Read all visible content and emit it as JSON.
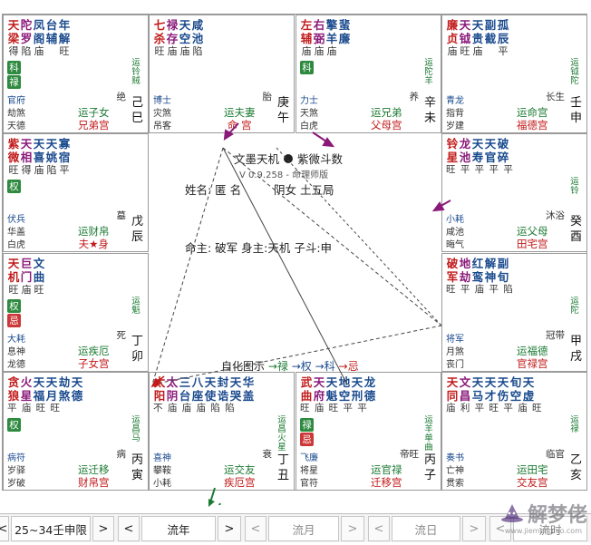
{
  "app": {
    "title": "文墨天机",
    "subtitle": "紫微斗数",
    "version": "V 0.9.258 - 命理师版"
  },
  "colors": {
    "green": "#1b7a32",
    "red": "#c21a1a",
    "blue": "#1a4a8e",
    "purple": "#8a1a7a"
  },
  "center": {
    "name_label": "姓名: 匿 名",
    "gender_label": "阴女 土五局",
    "ming_label": "命主: 破军 身主:天机 子斗:申",
    "legend_label": "自化图示",
    "legend_lu": "→禄",
    "legend_quan": "→权",
    "legend_ke": "→科",
    "legend_ji": "→忌"
  },
  "palaces": [
    {
      "id": "si",
      "stars": [
        [
          "天",
          "得"
        ],
        [
          "陀",
          "陷"
        ],
        [
          "凤",
          "庙"
        ],
        [
          "台",
          ""
        ],
        [
          "年",
          "旺"
        ]
      ],
      "stars2": [
        [
          "梁",
          ""
        ],
        [
          "罗",
          ""
        ],
        [
          "阁",
          ""
        ],
        [
          "辅",
          ""
        ],
        [
          "解",
          ""
        ]
      ],
      "badges": [
        "科",
        "禄"
      ],
      "minor1": "官府",
      "minor2": "劫煞",
      "minor3": "天德",
      "vlabel": "运铃贼",
      "stage": "绝",
      "gz1": "己",
      "gz2": "巳",
      "pal_top": "运子女",
      "pal_bot": "兄弟宫"
    },
    {
      "id": "wu",
      "stars": [
        [
          "七",
          "旺"
        ],
        [
          "禄",
          "庙"
        ],
        [
          "天",
          "庙"
        ],
        [
          "咸",
          "陷"
        ],
        [
          "",
          ""
        ]
      ],
      "stars2": [
        [
          "杀",
          ""
        ],
        [
          "存",
          ""
        ],
        [
          "空",
          ""
        ],
        [
          "池",
          ""
        ],
        [
          "",
          ""
        ]
      ],
      "badges": [],
      "minor1": "博士",
      "minor2": "灾煞",
      "minor3": "吊客",
      "vlabel": "",
      "stage": "胎",
      "gz1": "庚",
      "gz2": "午",
      "pal_top": "运夫妻",
      "pal_bot": "命 宫"
    },
    {
      "id": "wei",
      "stars": [
        [
          "左",
          "庙"
        ],
        [
          "右",
          "庙"
        ],
        [
          "擎",
          "庙"
        ],
        [
          "蜚",
          ""
        ],
        [
          "",
          ""
        ]
      ],
      "stars2": [
        [
          "辅",
          ""
        ],
        [
          "弼",
          ""
        ],
        [
          "羊",
          ""
        ],
        [
          "廉",
          ""
        ],
        [
          "",
          ""
        ]
      ],
      "badges": [
        "科"
      ],
      "minor1": "力士",
      "minor2": "天煞",
      "minor3": "白虎",
      "vlabel": "运陀羊",
      "stage": "养",
      "gz1": "辛",
      "gz2": "未",
      "pal_top": "运兄弟",
      "pal_bot": "父母宫"
    },
    {
      "id": "shen",
      "stars": [
        [
          "廉",
          "庙"
        ],
        [
          "天",
          "旺"
        ],
        [
          "天",
          "庙"
        ],
        [
          "副",
          ""
        ],
        [
          "孤",
          "平"
        ]
      ],
      "stars2": [
        [
          "贞",
          ""
        ],
        [
          "钺",
          ""
        ],
        [
          "贵",
          ""
        ],
        [
          "截",
          ""
        ],
        [
          "辰",
          ""
        ]
      ],
      "badges": [],
      "minor1": "青龙",
      "minor2": "指背",
      "minor3": "岁建",
      "vlabel": "运钺陀",
      "stage": "长生",
      "gz1": "壬",
      "gz2": "申",
      "pal_top": "运命宫",
      "pal_bot": "福德宫"
    },
    {
      "id": "chen",
      "stars": [
        [
          "紫",
          "旺"
        ],
        [
          "天",
          "得"
        ],
        [
          "天",
          "庙"
        ],
        [
          "天",
          "陷"
        ],
        [
          "寡",
          "平"
        ]
      ],
      "stars2": [
        [
          "微",
          ""
        ],
        [
          "相",
          ""
        ],
        [
          "喜",
          ""
        ],
        [
          "姚",
          ""
        ],
        [
          "宿",
          ""
        ]
      ],
      "badges": [
        "权"
      ],
      "minor1": "伏兵",
      "minor2": "华盖",
      "minor3": "白虎",
      "vlabel": "",
      "stage": "墓",
      "gz1": "戊",
      "gz2": "辰",
      "pal_top": "运财帛",
      "pal_bot": "夫★身"
    },
    {
      "id": "you",
      "stars": [
        [
          "铃",
          ""
        ],
        [
          "龙",
          ""
        ],
        [
          "天",
          ""
        ],
        [
          "天",
          ""
        ],
        [
          "破",
          ""
        ]
      ],
      "stars2": [
        [
          "星",
          ""
        ],
        [
          "池",
          ""
        ],
        [
          "寿",
          ""
        ],
        [
          "官",
          ""
        ],
        [
          "碎",
          ""
        ]
      ],
      "stars3": "旺 平 平 平 平",
      "badges": [],
      "minor1": "小耗",
      "minor2": "咸池",
      "minor3": "晦气",
      "vlabel": "运铃",
      "stage": "沐浴",
      "gz1": "癸",
      "gz2": "酉",
      "pal_top": "运父母",
      "pal_bot": "田宅宫"
    },
    {
      "id": "mao",
      "stars": [
        [
          "天",
          "旺"
        ],
        [
          "巨",
          "庙"
        ],
        [
          "文",
          "旺"
        ],
        [
          "",
          ""
        ],
        [
          "",
          ""
        ]
      ],
      "stars2": [
        [
          "机",
          ""
        ],
        [
          "门",
          ""
        ],
        [
          "曲",
          ""
        ],
        [
          "",
          ""
        ],
        [
          "",
          ""
        ]
      ],
      "badges": [
        "权",
        "忌"
      ],
      "minor1": "大耗",
      "minor2": "息神",
      "minor3": "龙德",
      "vlabel": "运魁",
      "stage": "死",
      "gz1": "丁",
      "gz2": "卯",
      "pal_top": "运疾厄",
      "pal_bot": "子女宫"
    },
    {
      "id": "xu",
      "stars": [
        [
          "破",
          ""
        ],
        [
          "地",
          ""
        ],
        [
          "红",
          ""
        ],
        [
          "解",
          ""
        ],
        [
          "副",
          ""
        ]
      ],
      "stars2": [
        [
          "军",
          ""
        ],
        [
          "劫",
          ""
        ],
        [
          "鸾",
          ""
        ],
        [
          "神",
          ""
        ],
        [
          "旬",
          ""
        ]
      ],
      "stars3": "旺 平 庙 平 陷",
      "extra": [
        [
          "大",
          ""
        ],
        [
          "月",
          ""
        ]
      ],
      "extra2": [
        [
          "耗",
          ""
        ],
        [
          "德",
          ""
        ]
      ],
      "badges": [],
      "minor1": "将军",
      "minor2": "月煞",
      "minor3": "丧门",
      "vlabel": "运陀",
      "stage": "冠带",
      "gz1": "甲",
      "gz2": "戌",
      "pal_top": "运福德",
      "pal_bot": "官禄宫"
    },
    {
      "id": "yin",
      "stars": [
        [
          "贪",
          ""
        ],
        [
          "火",
          ""
        ],
        [
          "天",
          ""
        ],
        [
          "天",
          ""
        ],
        [
          "劫",
          ""
        ],
        [
          "天",
          ""
        ]
      ],
      "stars2": [
        [
          "狼",
          ""
        ],
        [
          "星",
          ""
        ],
        [
          "福",
          ""
        ],
        [
          "月",
          ""
        ],
        [
          "煞",
          ""
        ],
        [
          "德",
          ""
        ]
      ],
      "stars3": "平 庙 旺 旺",
      "badges": [
        "权"
      ],
      "minor1": "病符",
      "minor2": "岁驿",
      "minor3": "岁破",
      "vlabel": "运昌 马",
      "stage": "病",
      "gz1": "丙",
      "gz2": "寅",
      "pal_top": "运迁移",
      "pal_bot": "财帛宫"
    },
    {
      "id": "chou",
      "stars": [
        [
          "太",
          ""
        ],
        [
          "太",
          ""
        ],
        [
          "三",
          ""
        ],
        [
          "八",
          ""
        ],
        [
          "天",
          ""
        ],
        [
          "封",
          ""
        ],
        [
          "天",
          ""
        ],
        [
          "华",
          ""
        ]
      ],
      "stars2": [
        [
          "阳",
          ""
        ],
        [
          "阴",
          ""
        ],
        [
          "台",
          ""
        ],
        [
          "座",
          ""
        ],
        [
          "使",
          ""
        ],
        [
          "诰",
          ""
        ],
        [
          "哭",
          ""
        ],
        [
          "盖",
          ""
        ]
      ],
      "stars3": "不 庙 庙 庙 陷 陷",
      "badges": [],
      "minor1": "喜神",
      "minor2": "攀鞍",
      "minor3": "小耗",
      "vlabel": "运昌 火星",
      "stage": "衰",
      "gz1": "丁",
      "gz2": "丑",
      "pal_top": "运交友",
      "pal_bot": "疾厄宫"
    },
    {
      "id": "zi",
      "stars": [
        [
          "武",
          ""
        ],
        [
          "天",
          ""
        ],
        [
          "天",
          ""
        ],
        [
          "地",
          ""
        ],
        [
          "天",
          ""
        ],
        [
          "龙",
          ""
        ]
      ],
      "stars2": [
        [
          "曲",
          ""
        ],
        [
          "府",
          ""
        ],
        [
          "魁",
          ""
        ],
        [
          "空",
          ""
        ],
        [
          "刑",
          ""
        ],
        [
          "德",
          ""
        ]
      ],
      "stars3": "旺 庙 旺 平 平",
      "badges": [
        "禄",
        "忌"
      ],
      "minor1": "飞廉",
      "minor2": "将星",
      "minor3": "官符",
      "vlabel": "运羊 单曲",
      "stage": "帝旺",
      "gz1": "丙",
      "gz2": "子",
      "pal_top": "运官禄",
      "pal_bot": "迁移宫"
    },
    {
      "id": "hai",
      "stars": [
        [
          "天",
          ""
        ],
        [
          "文",
          ""
        ],
        [
          "天",
          ""
        ],
        [
          "天",
          ""
        ],
        [
          "天",
          ""
        ],
        [
          "旬",
          ""
        ],
        [
          "天",
          ""
        ]
      ],
      "stars2": [
        [
          "同",
          ""
        ],
        [
          "昌",
          ""
        ],
        [
          "马",
          ""
        ],
        [
          "才",
          ""
        ],
        [
          "伤",
          ""
        ],
        [
          "空",
          ""
        ],
        [
          "虚",
          ""
        ]
      ],
      "stars3": "庙 利 平 旺 平 庙 旺",
      "badges": [],
      "minor1": "奏书",
      "minor2": "亡神",
      "minor3": "贯索",
      "vlabel": "运禄",
      "stage": "临官",
      "gz1": "乙",
      "gz2": "亥",
      "pal_top": "运田宅",
      "pal_bot": "交友宫"
    }
  ],
  "toolbar": {
    "prev1": "<",
    "range": "25~34壬申限",
    "next1": ">",
    "prev2": "<",
    "year": "流年",
    "next2": ">",
    "prev3": "<",
    "month": "流月",
    "next3": ">",
    "prev4": "<",
    "day": "流日",
    "next4": ">",
    "prev5": "<",
    "hour": "流时"
  },
  "watermark": {
    "text": "解梦佬",
    "url": "www.jiemenglao.com"
  }
}
